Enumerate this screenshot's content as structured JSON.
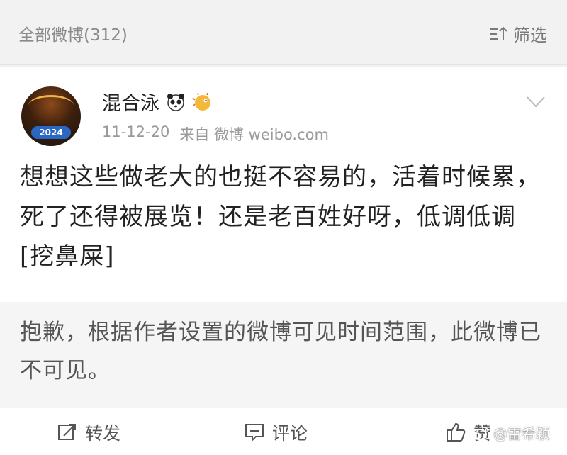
{
  "header": {
    "count_label": "全部微博(312)",
    "filter_label": "筛选",
    "filter_icon": "filter-icon"
  },
  "post": {
    "username": "混合泳",
    "badges": [
      "panda-emoji",
      "puffer-fish-emoji"
    ],
    "avatar_badge": "2024",
    "date": "11-12-20",
    "source": "来自 微博 weibo.com",
    "text": "想想这些做老大的也挺不容易的，活着时候累，死了还得被展览！还是老百姓好呀，低调低调[挖鼻屎]"
  },
  "notice": {
    "text": "抱歉，根据作者设置的微博可见时间范围，此微博已不可见。"
  },
  "actions": {
    "repost_label": "转发",
    "comment_label": "评论",
    "like_label": "赞"
  },
  "watermark": {
    "text": "@雷希颖"
  },
  "colors": {
    "background": "#f2f2f2",
    "card": "#ffffff",
    "muted_text": "#9a9a9a"
  }
}
